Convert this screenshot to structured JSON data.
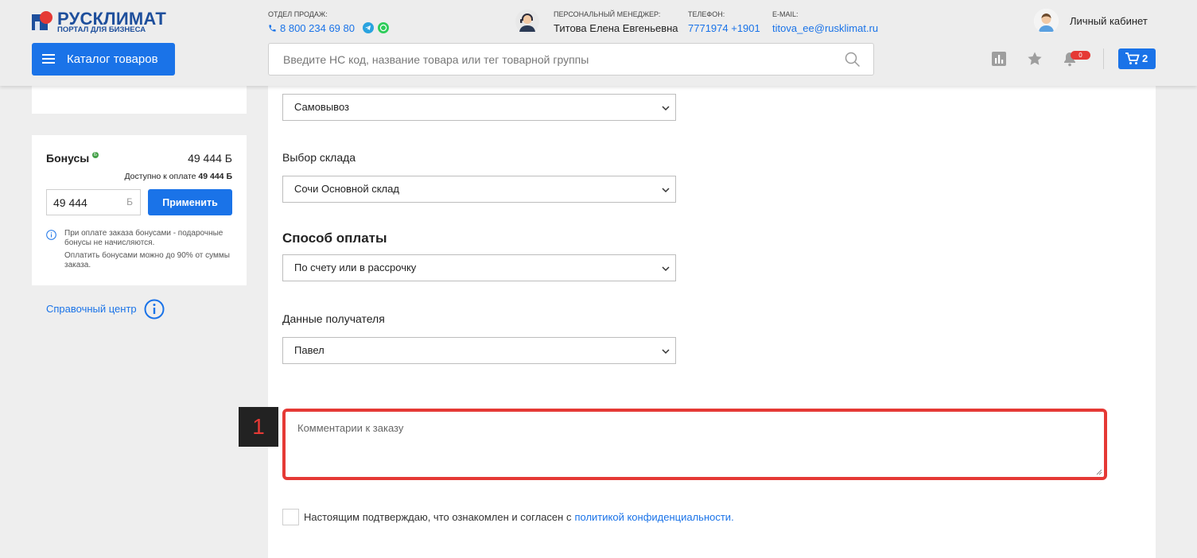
{
  "header": {
    "logo_title": "РУСКЛИМАТ",
    "logo_subtitle": "ПОРТАЛ ДЛЯ БИЗНЕСА",
    "catalog_button": "Каталог товаров",
    "sales_label": "ОТДЕЛ ПРОДАЖ:",
    "sales_phone": "8 800 234 69 80",
    "manager_label": "ПЕРСОНАЛЬНЫЙ МЕНЕДЖЕР:",
    "manager_name": "Титова Елена Евгеньевна",
    "phone_label": "ТЕЛЕФОН:",
    "phone_value": "7771974 +1901",
    "email_label": "E-MAIL:",
    "email_value": "titova_ee@rusklimat.ru",
    "cabinet_label": "Личный кабинет",
    "search_placeholder": "Введите НС код, название товара или тег товарной группы",
    "notifications_count": "0",
    "cart_count": "2",
    "brand_color": "#1a73e8"
  },
  "sidebar": {
    "bonus": {
      "title": "Бонусы",
      "icon_letter": "Б",
      "amount": "49 444 Б",
      "available_prefix": "Доступно к оплате",
      "available_value": "49 444 Б",
      "input_value": "49 444",
      "input_unit": "Б",
      "apply_button": "Применить",
      "note_line1": "При оплате заказа бонусами - подарочные бонусы не начисляются.",
      "note_line2": "Оплатить бонусами можно до 90% от суммы заказа."
    },
    "help_link": "Справочный центр"
  },
  "form": {
    "delivery_value": "Самовывоз",
    "warehouse_label": "Выбор склада",
    "warehouse_value": "Сочи Основной склад",
    "payment_title": "Способ оплаты",
    "payment_value": "По счету или в рассрочку",
    "recipient_label": "Данные получателя",
    "recipient_value": "Павел",
    "comment_placeholder": "Комментарии к заказу",
    "consent_text": "Настоящим подтверждаю, что ознакомлен и согласен с",
    "consent_link": "политикой конфиденциальности."
  },
  "annotation": {
    "step_number": "1",
    "highlight_color": "#e53935"
  }
}
